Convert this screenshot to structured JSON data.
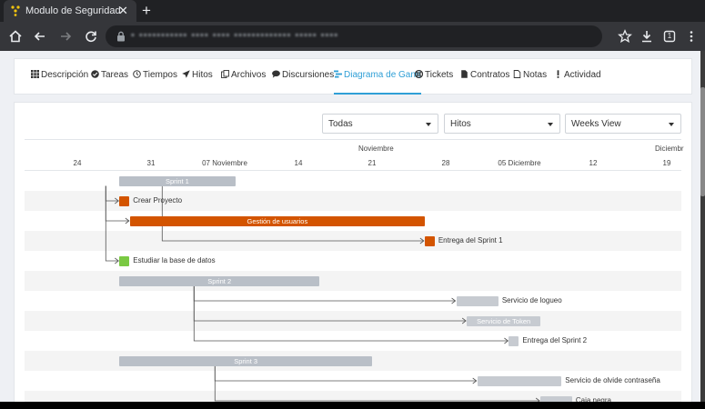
{
  "browser": {
    "tab_title": "Modulo de Seguridad",
    "tab_close": "✕",
    "new_tab": "+",
    "url": "• ••••••••••• •••• •••• ••••••••••••• ••••• ••••",
    "tab_count": "1"
  },
  "nav": {
    "items": [
      {
        "label": "Descripción",
        "icon": "grid-icon"
      },
      {
        "label": "Tareas",
        "icon": "check-circle-icon"
      },
      {
        "label": "Tiempos",
        "icon": "clock-icon"
      },
      {
        "label": "Hitos",
        "icon": "send-icon"
      },
      {
        "label": "Archivos",
        "icon": "files-icon"
      },
      {
        "label": "Discursiones",
        "icon": "chat-icon"
      },
      {
        "label": "Diagrama de Gantt",
        "icon": "gantt-icon",
        "active": true
      },
      {
        "label": "Tickets",
        "icon": "lifebuoy-icon"
      },
      {
        "label": "Contratos",
        "icon": "file-icon"
      },
      {
        "label": "Notas",
        "icon": "note-icon"
      },
      {
        "label": "Actividad",
        "icon": "exclamation-icon"
      }
    ]
  },
  "filters": {
    "status": "Todas",
    "type": "Hitos",
    "view": "Weeks View"
  },
  "timeline": {
    "months": [
      "Noviembre",
      "Diciembr"
    ],
    "ticks": [
      "24",
      "31",
      "07 Noviembre",
      "14",
      "21",
      "28",
      "05 Diciembre",
      "12",
      "19"
    ]
  },
  "tasks": [
    {
      "name": "Sprint 1",
      "type": "summary",
      "start": "2022-10-28",
      "end": "2022-11-08",
      "label_inside": true
    },
    {
      "name": "Crear Proyecto",
      "type": "milestone",
      "start": "2022-10-28",
      "color": "#d35400"
    },
    {
      "name": "Gestión de usuarios",
      "type": "task",
      "start": "2022-10-29",
      "end": "2022-11-26",
      "color": "#d35400",
      "label_inside": true
    },
    {
      "name": "Entrega del Sprint 1",
      "type": "milestone",
      "start": "2022-11-26",
      "color": "#d35400"
    },
    {
      "name": "Estudiar la base de datos",
      "type": "milestone",
      "start": "2022-10-28",
      "color": "#7ac943"
    },
    {
      "name": "Sprint 2",
      "type": "summary",
      "start": "2022-10-28",
      "end": "2022-11-16",
      "label_inside": true
    },
    {
      "name": "Servicio de logueo",
      "type": "task",
      "start": "2022-11-29",
      "end": "2022-12-03",
      "color": "#c7cbd1"
    },
    {
      "name": "Servicio de Token",
      "type": "task",
      "start": "2022-11-30",
      "end": "2022-12-07",
      "color": "#c7cbd1",
      "label_inside": true
    },
    {
      "name": "Entrega del Sprint 2",
      "type": "milestone",
      "start": "2022-12-04",
      "color": "#c7cbd1"
    },
    {
      "name": "Sprint 3",
      "type": "summary",
      "start": "2022-10-28",
      "end": "2022-11-21",
      "label_inside": true
    },
    {
      "name": "Servicio de olvide contraseña",
      "type": "task",
      "start": "2022-12-01",
      "end": "2022-12-09",
      "color": "#c7cbd1"
    },
    {
      "name": "Caja negra",
      "type": "task",
      "start": "2022-12-07",
      "end": "2022-12-10",
      "color": "#c7cbd1"
    }
  ],
  "links": [
    {
      "from": 0,
      "to": 1
    },
    {
      "from": 0,
      "to": 2
    },
    {
      "from": 0,
      "to": 3
    },
    {
      "from": 0,
      "to": 4
    },
    {
      "from": 5,
      "to": 6
    },
    {
      "from": 5,
      "to": 7
    },
    {
      "from": 5,
      "to": 8
    },
    {
      "from": 9,
      "to": 10
    },
    {
      "from": 9,
      "to": 11
    }
  ],
  "colors": {
    "accent": "#2f9fd6",
    "summary_bar": "#b9bfc7",
    "link": "#555555"
  }
}
